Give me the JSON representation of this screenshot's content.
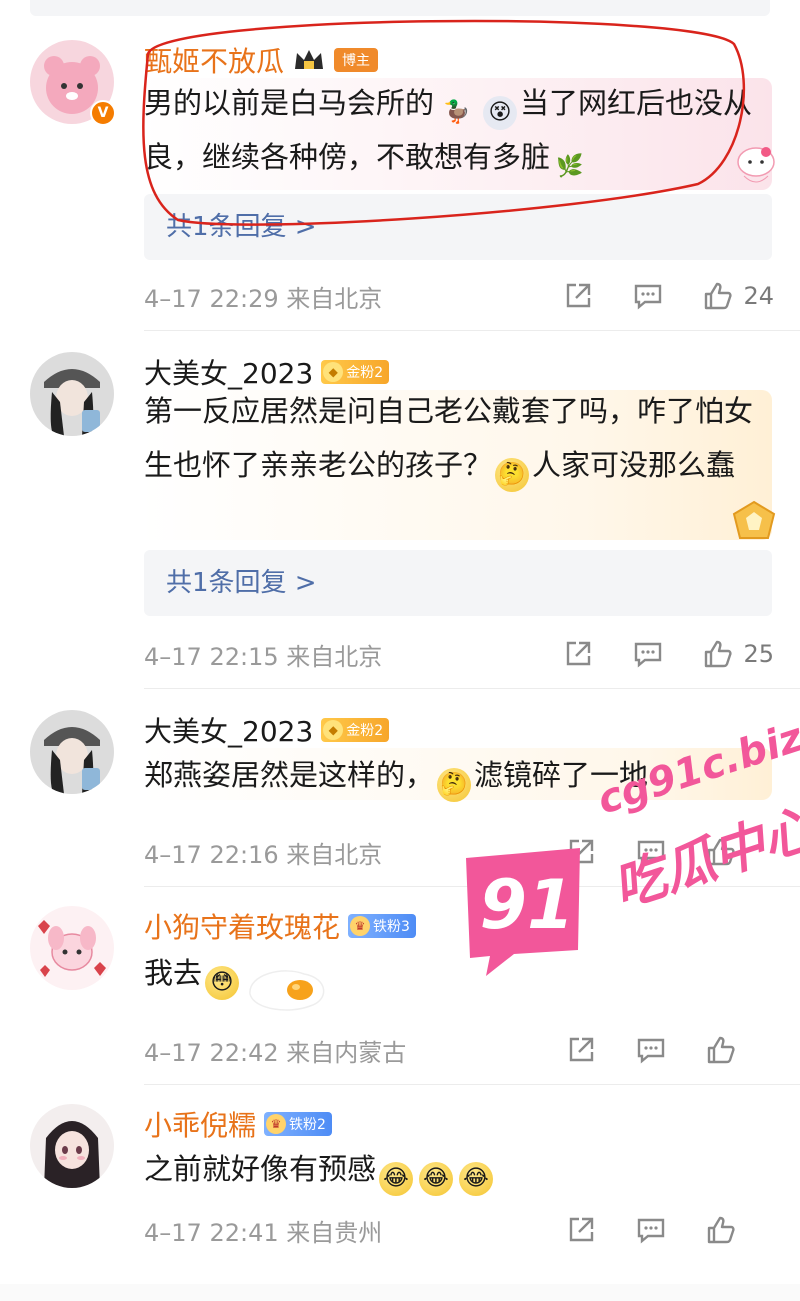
{
  "comments": [
    {
      "username": "甄姬不放瓜",
      "badge": "博主",
      "text_parts": [
        "男的以前是白马会所的",
        "当了网红后也没从良，继续各种傍，不敢想有多脏"
      ],
      "reply": "共1条回复 >",
      "meta": "4–17 22:29 来自北京",
      "likes": "24",
      "avatar_icon": "pink-bear-avatar",
      "verified_icon": "verified-v-icon"
    },
    {
      "username": "大美女_2023",
      "badge": "金粉2",
      "text_parts": [
        "第一反应居然是问自己老公戴套了吗，咋了怕女生也怀了亲亲老公的孩子？",
        "人家可没那么蠢"
      ],
      "reply": "共1条回复 >",
      "meta": "4–17 22:15 来自北京",
      "likes": "25",
      "avatar_icon": "girl-cap-avatar"
    },
    {
      "username": "大美女_2023",
      "badge": "金粉2",
      "text_parts": [
        "郑燕姿居然是这样的，",
        "滤镜碎了一地"
      ],
      "meta": "4–17 22:16 来自北京",
      "likes": "",
      "avatar_icon": "girl-cap-avatar"
    },
    {
      "username": "小狗守着玫瑰花",
      "badge": "铁粉3",
      "text_parts": [
        "我去"
      ],
      "meta": "4–17 22:42 来自内蒙古",
      "likes": "",
      "avatar_icon": "pink-puppy-avatar"
    },
    {
      "username": "小乖倪糯",
      "badge": "铁粉2",
      "text_parts": [
        "之前就好像有预感"
      ],
      "meta": "4–17 22:41 来自贵州",
      "likes": "",
      "avatar_icon": "anime-girl-avatar"
    }
  ],
  "watermark": {
    "number": "91",
    "url": "cg91c.biz",
    "slogan": "吃瓜中心"
  },
  "colors": {
    "orange_name": "#e8731a",
    "reply_link": "#4f6ea8",
    "meta_gray": "#9a9a9a",
    "watermark_pink": "#f2579a",
    "annotation_red": "#d9241c"
  }
}
